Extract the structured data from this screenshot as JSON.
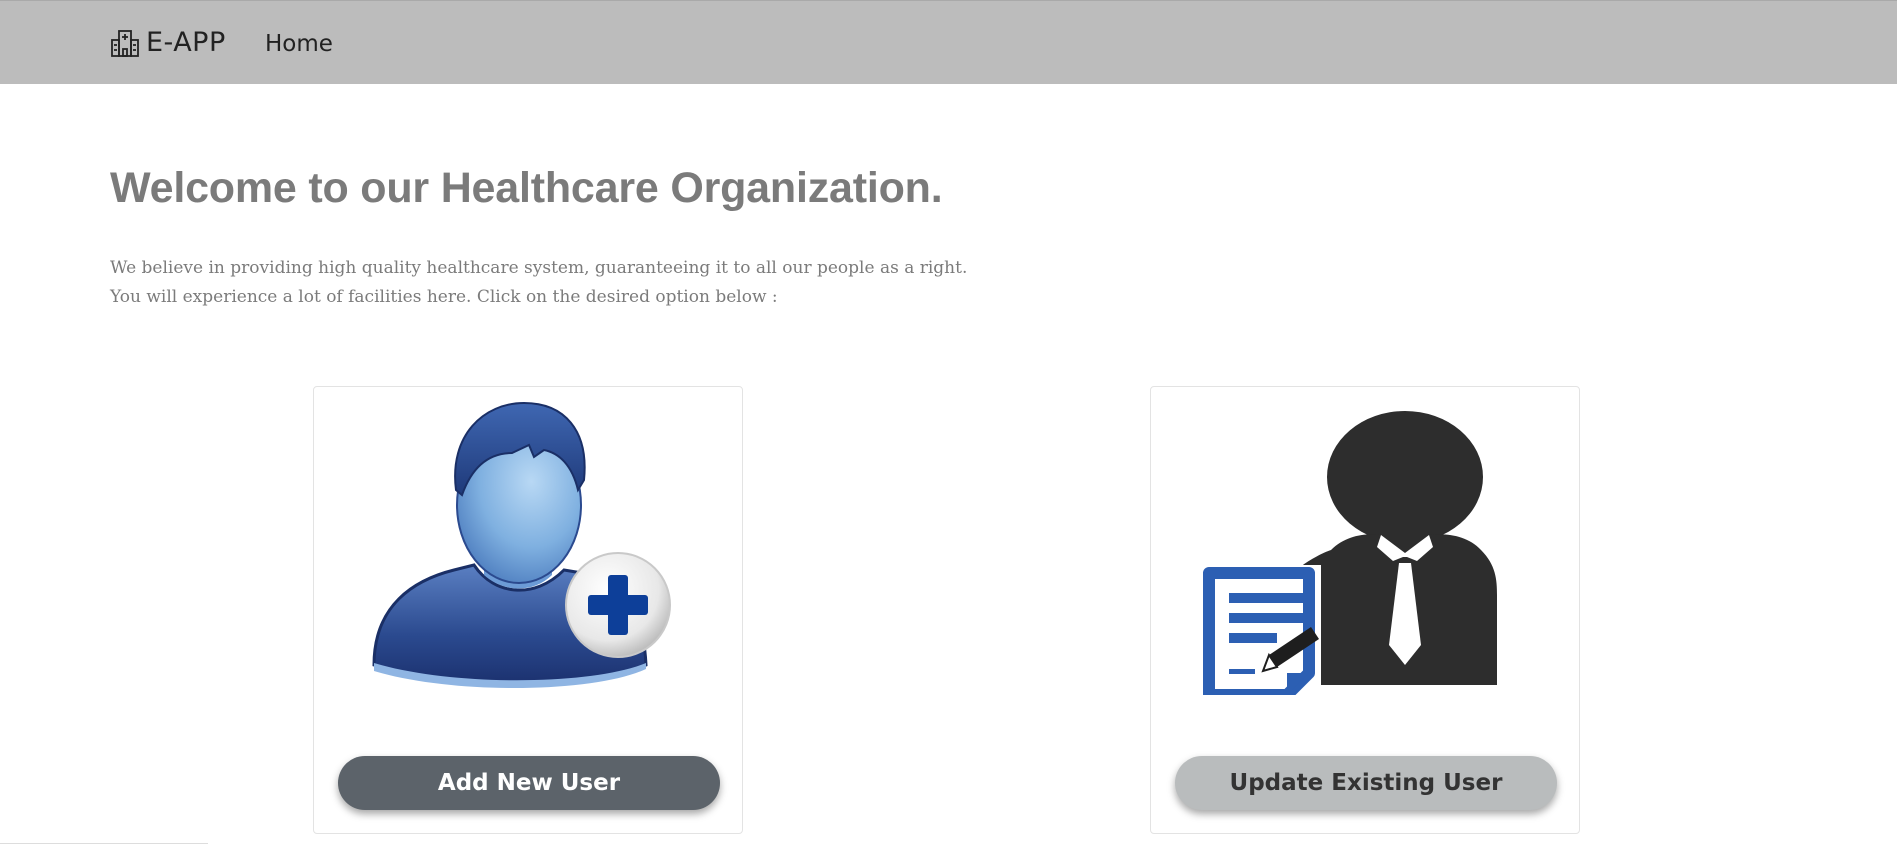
{
  "navbar": {
    "brand_icon": "hospital-building-icon",
    "brand_text": "E-APP",
    "home_label": "Home"
  },
  "main": {
    "title": "Welcome to our Healthcare Organization.",
    "intro_line_1": "We believe in providing high quality healthcare system, guaranteeing it to all our people as a right.",
    "intro_line_2": "You will experience a lot of facilities here. Click on the desired option below :"
  },
  "cards": [
    {
      "icon": "add-user-icon",
      "button_label": "Add New User"
    },
    {
      "icon": "update-user-document-icon",
      "button_label": "Update Existing User"
    }
  ],
  "colors": {
    "navbar_bg": "#bcbcbc",
    "title_text": "#7b7b7b",
    "add_button_bg": "#5c636a",
    "update_button_bg": "#b9bcbd"
  }
}
